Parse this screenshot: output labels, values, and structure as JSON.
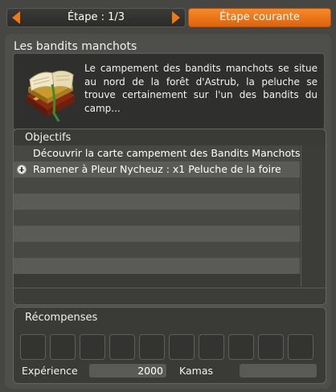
{
  "header": {
    "step_label": "Étape : 1/3",
    "current_step_button": "Étape courante",
    "prev_icon": "arrow-left-icon",
    "next_icon": "arrow-right-icon",
    "accent_color": "#f07a12"
  },
  "quest": {
    "title": "Les bandits manchots",
    "description": "Le campement des bandits manchots se situe au nord de la forêt d'Astrub, la peluche se trouve certainement sur l'un des bandits du camp...",
    "icon": "quest-book-icon"
  },
  "objectives": {
    "header": "Objectifs",
    "items": [
      {
        "text": "Découvrir la carte campement des Bandits Manchots",
        "has_icon": false
      },
      {
        "text": "Ramener à Pleur Nycheuz : x1 Peluche de la foire",
        "has_icon": true,
        "icon": "plus-circle-icon"
      },
      {
        "text": ""
      },
      {
        "text": ""
      },
      {
        "text": ""
      },
      {
        "text": ""
      },
      {
        "text": ""
      },
      {
        "text": ""
      }
    ]
  },
  "rewards": {
    "header": "Récompenses",
    "slot_count": 10,
    "experience_label": "Expérience",
    "experience_value": "2000",
    "kamas_label": "Kamas",
    "kamas_value": ""
  }
}
